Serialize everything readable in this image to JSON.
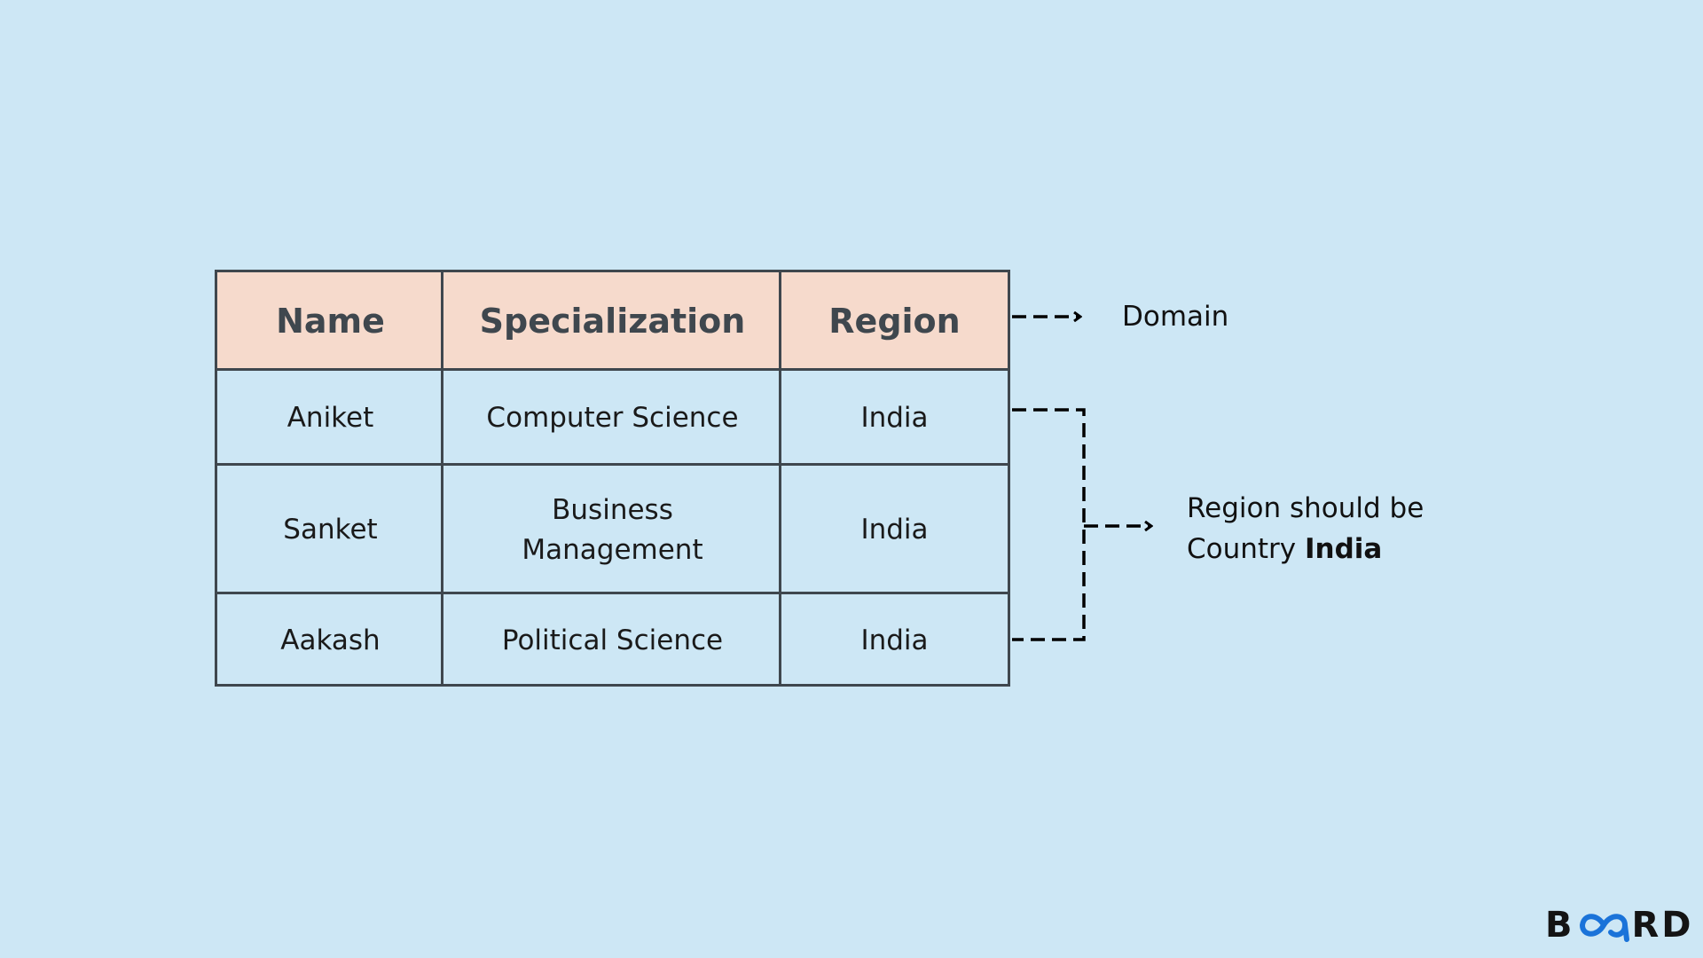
{
  "table": {
    "headers": [
      "Name",
      "Specialization",
      "Region"
    ],
    "rows": [
      [
        "Aniket",
        "Computer Science",
        "India"
      ],
      [
        "Sanket",
        "Business Management",
        "India"
      ],
      [
        "Aakash",
        "Political Science",
        "India"
      ]
    ],
    "header_bg": "#f6dacc",
    "border_color": "#3f474e"
  },
  "annotations": {
    "domain_label": "Domain",
    "region_label_line1": "Region should be",
    "region_label_prefix": "Country",
    "region_label_bold": "India"
  },
  "logo": {
    "left": "B",
    "right": "RD",
    "icon": "infinity-icon",
    "icon_color": "#1a73d9"
  },
  "colors": {
    "background": "#cde7f5"
  }
}
